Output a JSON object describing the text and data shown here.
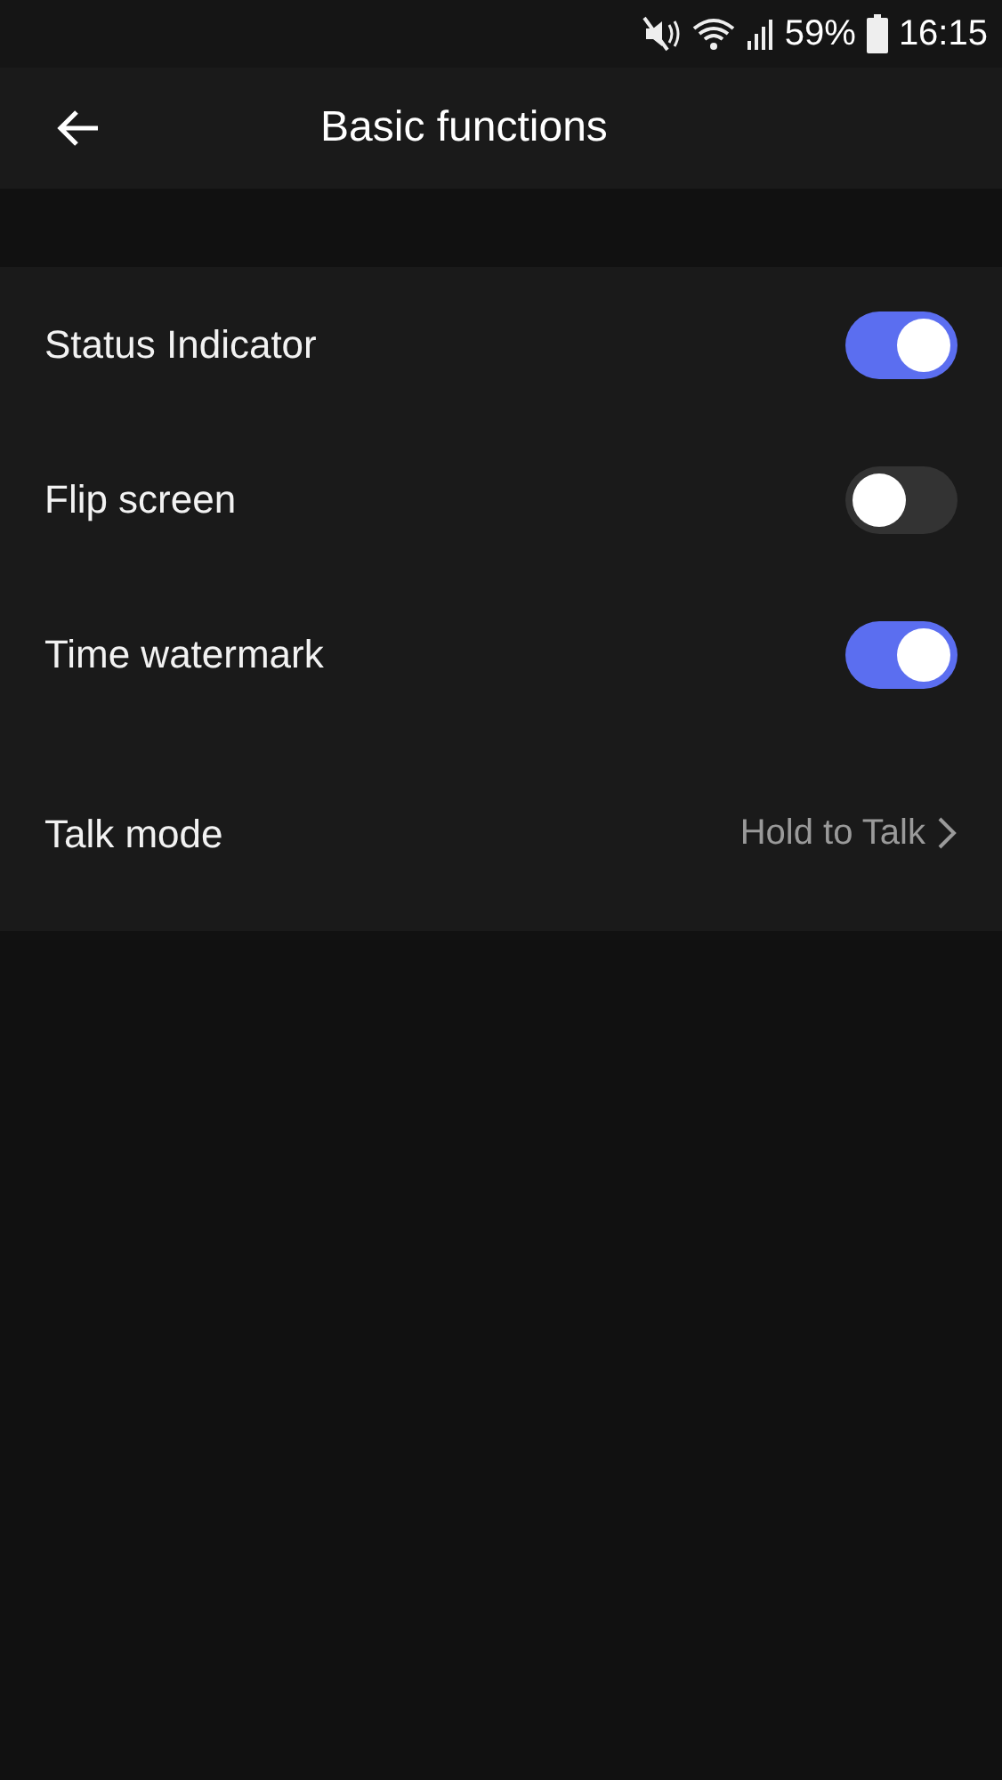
{
  "status_bar": {
    "battery": "59%",
    "time": "16:15"
  },
  "header": {
    "title": "Basic functions"
  },
  "settings": [
    {
      "kind": "toggle",
      "label": "Status Indicator",
      "on": true
    },
    {
      "kind": "toggle",
      "label": "Flip screen",
      "on": false
    },
    {
      "kind": "toggle",
      "label": "Time watermark",
      "on": true
    },
    {
      "kind": "link",
      "label": "Talk mode",
      "value": "Hold to Talk"
    }
  ]
}
